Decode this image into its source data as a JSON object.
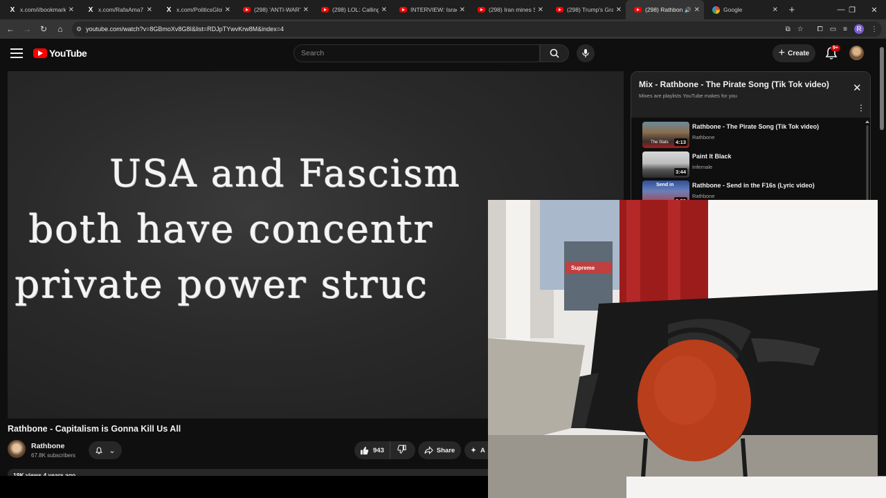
{
  "browser": {
    "tabs": [
      {
        "icon": "x-icon",
        "title": "x.com/i/bookmark"
      },
      {
        "icon": "x-icon",
        "title": "x.com/RafaAma7"
      },
      {
        "icon": "x-icon",
        "title": "x.com/PoliticsGlob"
      },
      {
        "icon": "youtube-icon",
        "title": "(298) 'ANTI-WAR'"
      },
      {
        "icon": "youtube-icon",
        "title": "(298) LOL: Calling"
      },
      {
        "icon": "youtube-icon",
        "title": "INTERVIEW: Israel"
      },
      {
        "icon": "youtube-icon",
        "title": "(298) Iran mines S"
      },
      {
        "icon": "youtube-icon",
        "title": "(298) Trump's Gra"
      },
      {
        "icon": "youtube-icon",
        "title": "(298) Rathbon",
        "active": true
      },
      {
        "icon": "google-icon",
        "title": "Google"
      }
    ],
    "url": "youtube.com/watch?v=8GBmoXv8G8I&list=RDJpTYwvKrw8M&index=4",
    "profile_initial": "R"
  },
  "youtube": {
    "logo_text": "YouTube",
    "search_placeholder": "Search",
    "create_label": "Create",
    "notification_badge": "9+"
  },
  "video": {
    "chalk_lines": [
      "USA and Fascism",
      "both have concentr",
      "private power struc"
    ],
    "title": "Rathbone - Capitalism is Gonna Kill Us All",
    "channel": "Rathbone",
    "subscribers": "67.8K subscribers",
    "likes": "943",
    "share_label": "Share",
    "more_label": "A",
    "description_meta": "19K views  4 years ago"
  },
  "playlist": {
    "title": "Mix - Rathbone - The Pirate Song (Tik Tok video)",
    "subtitle": "Mixes are playlists YouTube makes for you",
    "items": [
      {
        "title": "Rathbone - The Pirate Song (Tik Tok video)",
        "channel": "Rathbone",
        "duration": "4:13",
        "thumb_label": "The Stats"
      },
      {
        "title": "Paint It Black",
        "channel": "Infernale",
        "duration": "3:44"
      },
      {
        "title": "Rathbone - Send in the F16s (Lyric video)",
        "channel": "Rathbone",
        "duration": "2:59",
        "thumb_label": "Send in"
      }
    ]
  },
  "webcam": {
    "sticker_text": "Supreme"
  }
}
